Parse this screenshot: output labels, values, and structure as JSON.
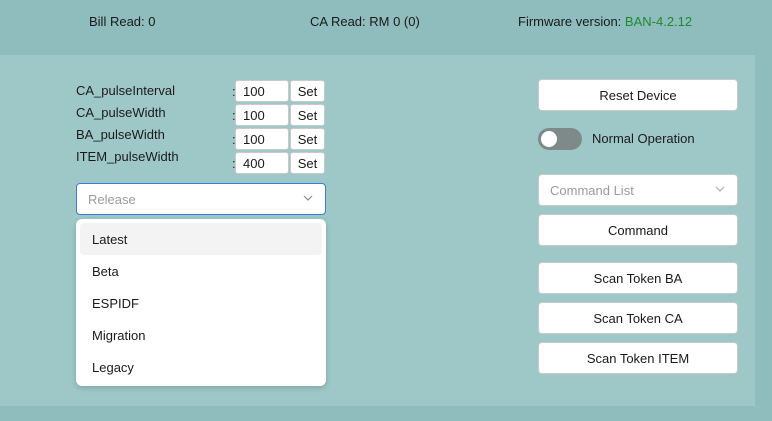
{
  "status": {
    "bill_read": "Bill Read: 0",
    "ca_read": "CA Read: RM 0 (0)",
    "firmware_label": "Firmware version: ",
    "firmware_value": "BAN-4.2.12"
  },
  "params": [
    {
      "label": "CA_pulseInterval",
      "value": "100",
      "set_label": "Set"
    },
    {
      "label": "CA_pulseWidth",
      "value": "100",
      "set_label": "Set"
    },
    {
      "label": "BA_pulseWidth",
      "value": "100",
      "set_label": "Set"
    },
    {
      "label": "ITEM_pulseWidth",
      "value": "400",
      "set_label": "Set"
    }
  ],
  "colon": ":",
  "release": {
    "placeholder": "Release",
    "options": [
      "Latest",
      "Beta",
      "ESPIDF",
      "Migration",
      "Legacy"
    ],
    "highlighted": "Latest"
  },
  "right": {
    "reset_button": "Reset Device",
    "toggle_label": "Normal Operation",
    "toggle_on": false,
    "command_list_placeholder": "Command List",
    "command_button": "Command",
    "scan_ba": "Scan Token BA",
    "scan_ca": "Scan Token CA",
    "scan_item": "Scan Token ITEM"
  },
  "colors": {
    "background": "#8fbcbd",
    "panel": "#9ec8c7",
    "firmware_value": "#1e8a2e",
    "focus_border": "#3a7bd5"
  }
}
